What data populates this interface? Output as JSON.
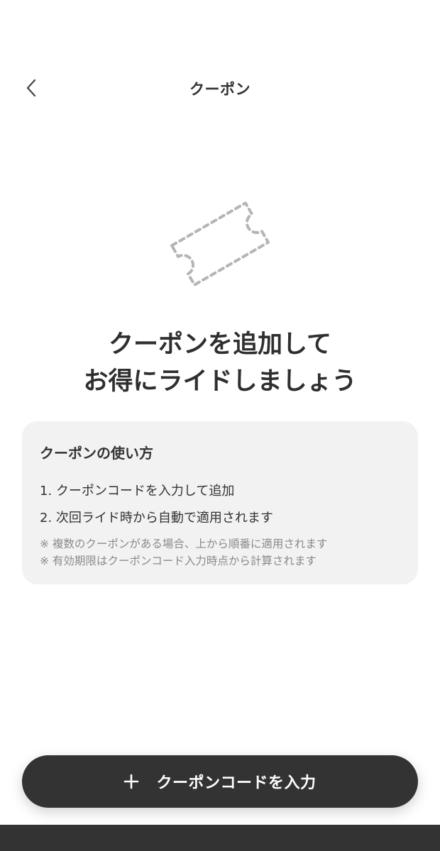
{
  "header": {
    "title": "クーポン",
    "back_icon": "chevron-left-icon"
  },
  "illustration": {
    "icon": "dashed-ticket-icon",
    "stroke_color": "#b5b5b5"
  },
  "headline": {
    "line1": "クーポンを追加して",
    "line2": "お得にライドしましょう"
  },
  "howto": {
    "title": "クーポンの使い方",
    "steps": [
      "1. クーポンコードを入力して追加",
      "2. 次回ライド時から自動で適用されます"
    ],
    "notes": [
      "※ 複数のクーポンがある場合、上から順番に適用されます",
      "※ 有効期限はクーポンコード入力時点から計算されます"
    ]
  },
  "cta": {
    "icon": "plus-icon",
    "label": "クーポンコードを入力"
  },
  "colors": {
    "primary_dark": "#333333",
    "card_background": "#f2f2f2",
    "note_text": "#8a8a8a",
    "background": "#ffffff"
  }
}
